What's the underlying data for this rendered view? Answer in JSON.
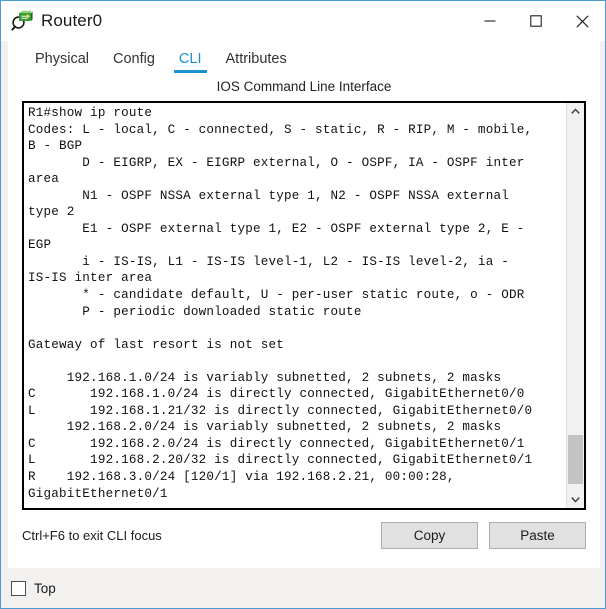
{
  "window": {
    "title": "Router0",
    "icon": "router-icon",
    "controls": {
      "minimize_label": "−",
      "maximize_label": "☐",
      "close_label": "✕"
    }
  },
  "tabs": [
    {
      "label": "Physical",
      "active": false
    },
    {
      "label": "Config",
      "active": false
    },
    {
      "label": "CLI",
      "active": true
    },
    {
      "label": "Attributes",
      "active": false
    }
  ],
  "panel": {
    "title": "IOS Command Line Interface"
  },
  "terminal": {
    "lines": [
      "R1#show ip route",
      "Codes: L - local, C - connected, S - static, R - RIP, M - mobile,",
      "B - BGP",
      "       D - EIGRP, EX - EIGRP external, O - OSPF, IA - OSPF inter",
      "area",
      "       N1 - OSPF NSSA external type 1, N2 - OSPF NSSA external",
      "type 2",
      "       E1 - OSPF external type 1, E2 - OSPF external type 2, E -",
      "EGP",
      "       i - IS-IS, L1 - IS-IS level-1, L2 - IS-IS level-2, ia -",
      "IS-IS inter area",
      "       * - candidate default, U - per-user static route, o - ODR",
      "       P - periodic downloaded static route",
      "",
      "Gateway of last resort is not set",
      "",
      "     192.168.1.0/24 is variably subnetted, 2 subnets, 2 masks",
      "C       192.168.1.0/24 is directly connected, GigabitEthernet0/0",
      "L       192.168.1.21/32 is directly connected, GigabitEthernet0/0",
      "     192.168.2.0/24 is variably subnetted, 2 subnets, 2 masks",
      "C       192.168.2.0/24 is directly connected, GigabitEthernet0/1",
      "L       192.168.2.20/32 is directly connected, GigabitEthernet0/1",
      "R    192.168.3.0/24 [120/1] via 192.168.2.21, 00:00:28,",
      "GigabitEthernet0/1"
    ]
  },
  "scrollbar": {
    "up_arrow": "chevron-up-icon",
    "down_arrow": "chevron-down-icon",
    "thumb_top_pct": 85,
    "thumb_height_pct": 13
  },
  "bottom": {
    "hint": "Ctrl+F6 to exit CLI focus",
    "copy_label": "Copy",
    "paste_label": "Paste"
  },
  "footer": {
    "top_label": "Top",
    "top_checked": false
  },
  "colors": {
    "accent": "#1a8fd1",
    "window_border": "#4a9ad4",
    "terminal_text": "#111111",
    "button_face": "#e1e1e1"
  }
}
